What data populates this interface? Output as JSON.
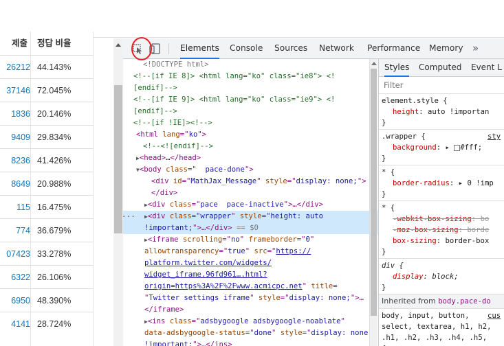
{
  "page_table": {
    "headers": [
      "제출",
      "정답 비율"
    ],
    "rows": [
      {
        "c1": "26212",
        "c2": "44.143%"
      },
      {
        "c1": "37146",
        "c2": "72.045%"
      },
      {
        "c1": "1836",
        "c2": "20.146%"
      },
      {
        "c1": "9409",
        "c2": "29.834%"
      },
      {
        "c1": "8236",
        "c2": "41.426%"
      },
      {
        "c1": "8649",
        "c2": "20.988%"
      },
      {
        "c1": "115",
        "c2": "16.475%"
      },
      {
        "c1": "774",
        "c2": "36.679%"
      },
      {
        "c1": "07423",
        "c2": "33.278%"
      },
      {
        "c1": "6322",
        "c2": "26.106%"
      },
      {
        "c1": "6950",
        "c2": "48.390%"
      },
      {
        "c1": "4141",
        "c2": "28.724%"
      }
    ]
  },
  "toolbar": {
    "inspect_icon": "inspect-element-icon",
    "device_icon": "device-toolbar-icon",
    "tabs": [
      "Elements",
      "Console",
      "Sources",
      "Network",
      "Performance",
      "Memory"
    ],
    "more": "»"
  },
  "elements": {
    "l1": "<!DOCTYPE html>",
    "l2": "<!--[if IE 8]> <html lang=\"ko\" class=\"ie8\"> <!",
    "l3": "[endif]-->",
    "l4": "<!--[if IE 9]> <html lang=\"ko\" class=\"ie9\"> <!",
    "l5": "[endif]-->",
    "l6": "<!--[if !IE]><!-->",
    "l7a": "<html ",
    "l7b": "lang",
    "l7c": "=\"",
    "l7d": "ko",
    "l7e": "\">",
    "l8": "<!--<![endif]-->",
    "l9a": "<head>",
    "l9b": "…",
    "l9c": "</head>",
    "l10a": "<body ",
    "l10b": "class",
    "l10c": "=\"",
    "l10d": "  pace-done",
    "l10e": "\">",
    "l11a": "<div ",
    "l11b": "id",
    "l11c": "MathJax_Message",
    "l11d": "style",
    "l11e": "display: none;",
    "l12": "</div>",
    "l13a": "<div ",
    "l13b": "class",
    "l13c": "pace  pace-inactive",
    "l13d": "…</div>",
    "l14a": "<div ",
    "l14b": "class",
    "l14c": "wrapper",
    "l14d": "style",
    "l14e": "height: auto",
    "l15a": "!important;",
    "l15b": ">…</div>",
    "l15c": " == $0",
    "l16a": "<iframe ",
    "l16b": "scrolling",
    "l16c": "no",
    "l16d": "frameborder",
    "l16e": "0",
    "l17a": "allowtransparency",
    "l17b": "true",
    "l17c": "src",
    "l17d": "https://",
    "l18": "platform.twitter.com/widgets/",
    "l19": "widget_iframe.96fd961….html?",
    "l20a": "origin=https%3A%2F%2Fwww.acmicpc.net",
    "l20b": "title",
    "l21a": "Twitter settings iframe",
    "l21b": "style",
    "l21c": "display: none;",
    "l21d": ">…",
    "l22": "</iframe>",
    "l23a": "<ins ",
    "l23b": "class",
    "l23c": "adsbygoogle adsbygoogle-noablate",
    "l24a": "data-adsbygoogle-status",
    "l24b": "done",
    "l24c": "style",
    "l24d": "display: none",
    "l25a": "!important;",
    "l25b": ">…</ins>"
  },
  "styles": {
    "tabs": [
      "Styles",
      "Computed",
      "Event L"
    ],
    "filter_placeholder": "Filter",
    "r1_sel": "element.style {",
    "r1_p": "height",
    "r1_v": ": auto !importan",
    "r1_end": "}",
    "r2_sel": ".wrapper {",
    "r2_src": "sty",
    "r2_p": "background",
    "r2_v": "#fff;",
    "r2_end": "}",
    "r3_sel": "* {",
    "r3_p": "border-radius",
    "r3_v": "0 !imp",
    "r3_end": "}",
    "r4_sel": "* {",
    "r4_p1": "-webkit-box-sizing",
    "r4_v1": ": bo",
    "r4_p2": "-moz-box-sizing",
    "r4_v2": ": borde",
    "r4_p3": "box-sizing",
    "r4_v3": ": border-box",
    "r4_end": "}",
    "r5_sel": "div {",
    "r5_p": "display",
    "r5_v": ": block;",
    "r5_end": "}",
    "inherited_label": "Inherited from",
    "inherited_link": "body.pace-do",
    "r6_l1": "body, input, button,",
    "r6_src": "cus",
    "r6_l2": "select, textarea, h1, h2,",
    "r6_l3": ".h1, .h2, .h3, .h4, .h5,",
    "r6_l4": "{"
  }
}
